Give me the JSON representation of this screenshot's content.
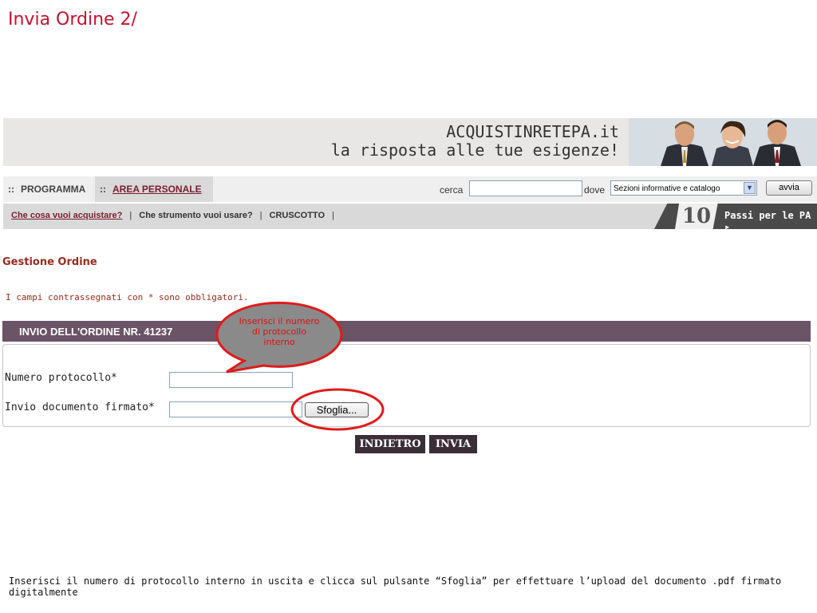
{
  "slide": {
    "title": "Invia Ordine 2/"
  },
  "banner": {
    "line1": "ACQUISTINRETEPA.it",
    "line2": "la risposta alle tue esigenze!"
  },
  "nav": {
    "tab_programma": "PROGRAMMA",
    "tab_area_personale": "AREA PERSONALE",
    "search_label": "cerca",
    "search_value": "",
    "dove_label": "dove",
    "dove_selected": "Sezioni informative e catalogo",
    "avvia_label": "avvia"
  },
  "subnav": {
    "link1": "Che cosa vuoi acquistare?",
    "link2": "Che strumento vuoi usare?",
    "link3": "CRUSCOTTO",
    "separator": "|",
    "promo_number": "10",
    "promo_text": "Passi per le PA ▸"
  },
  "page": {
    "section_title": "Gestione Ordine",
    "required_note": "I campi contrassegnati con * sono obbligatori.",
    "order_header": "INVIO DELL'ORDINE NR. 41237"
  },
  "form": {
    "protocol_label": "Numero protocollo*",
    "protocol_value": "",
    "document_label": "Invio documento firmato*",
    "document_value": "",
    "browse_label": "Sfoglia..."
  },
  "actions": {
    "back_label": "INDIETRO",
    "send_label": "INVIA"
  },
  "callout": {
    "text": "Inserisci il numero di protocollo interno"
  },
  "footer": {
    "note": "Inserisci il numero di protocollo interno in uscita e clicca sul pulsante “Sfoglia” per effettuare l’upload del documento .pdf firmato digitalmente"
  },
  "colors": {
    "title_red": "#c8102e",
    "header_purple": "#6b5466",
    "button_dark": "#3a2f38",
    "annotation_red": "#e01b1b",
    "callout_grey": "#8a8a8a"
  }
}
